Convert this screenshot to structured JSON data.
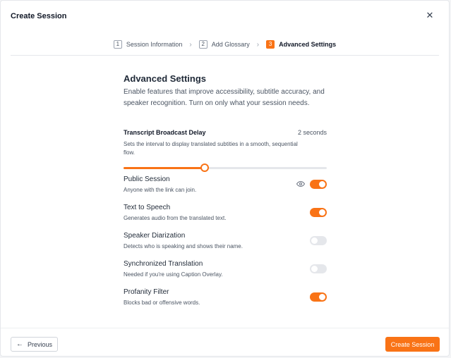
{
  "dialog": {
    "title": "Create Session",
    "close_icon": "close-icon",
    "close_glyph": "✕"
  },
  "stepper": {
    "steps": [
      {
        "number": "1",
        "label": "Session Information",
        "active": false
      },
      {
        "number": "2",
        "label": "Add Glossary",
        "active": false
      },
      {
        "number": "3",
        "label": "Advanced Settings",
        "active": true
      }
    ],
    "separator_glyph": "›"
  },
  "advanced": {
    "title": "Advanced Settings",
    "description": "Enable features that improve accessibility, subtitle accuracy, and speaker recognition. Turn on only what your session needs."
  },
  "broadcast_delay": {
    "label": "Transcript Broadcast Delay",
    "value_text": "2 seconds",
    "description": "Sets the interval to display translated subtities in a smooth, sequential flow.",
    "slider_fraction": 0.4
  },
  "settings": [
    {
      "name": "Public Session",
      "description": "Anyone with the link can join.",
      "enabled": true,
      "icon": "eye-icon"
    },
    {
      "name": "Text to Speech",
      "description": "Generates audio from the translated text.",
      "enabled": true
    },
    {
      "name": "Speaker Diarization",
      "description": "Detects who is speaking and shows their name.",
      "enabled": false
    },
    {
      "name": "Synchronized Translation",
      "description": "Needed if you're using Caption Overlay.",
      "enabled": false
    },
    {
      "name": "Profanity Filter",
      "description": "Blocks bad or offensive words.",
      "enabled": true
    }
  ],
  "footer": {
    "previous_label": "Previous",
    "previous_icon": "arrow-left-icon",
    "previous_glyph": "←",
    "create_label": "Create Session"
  },
  "colors": {
    "accent": "#f97316",
    "toggle_off": "#e5e7eb",
    "text_primary": "#1f2937",
    "text_secondary": "#4b5563"
  }
}
